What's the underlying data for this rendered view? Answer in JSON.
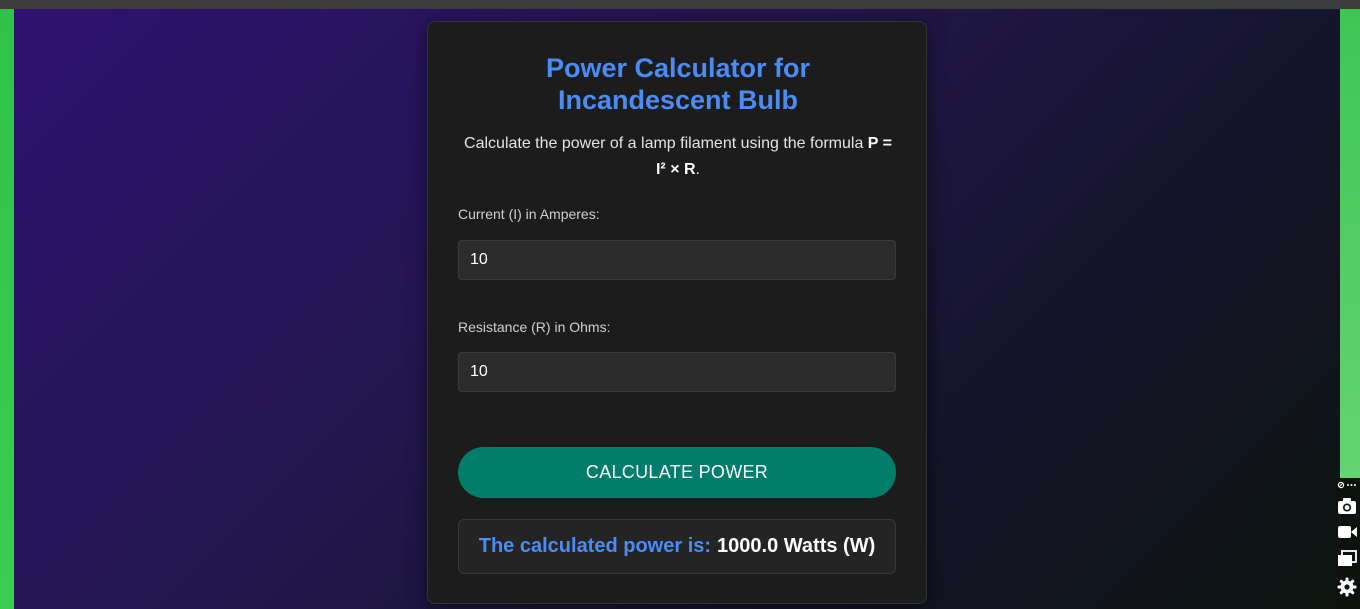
{
  "calculator": {
    "title": "Power Calculator for Incandescent Bulb",
    "description_prefix": "Calculate the power of a lamp filament using the formula ",
    "formula": "P = I² × R",
    "description_suffix": ".",
    "current_label": "Current (I) in Amperes:",
    "current_value": "10",
    "resistance_label": "Resistance (R) in Ohms:",
    "resistance_value": "10",
    "button_label": "CALCULATE POWER",
    "result_label": "The calculated power is:",
    "result_value": "1000.0 Watts (W)"
  },
  "side_toolbar": {
    "icons": [
      "link-icon",
      "more-icon",
      "camera-icon",
      "video-icon",
      "windows-icon",
      "gear-icon"
    ]
  },
  "colors": {
    "accent_blue": "#4a8cf5",
    "button_teal": "#007d6b",
    "card_bg": "#1c1c1c"
  }
}
